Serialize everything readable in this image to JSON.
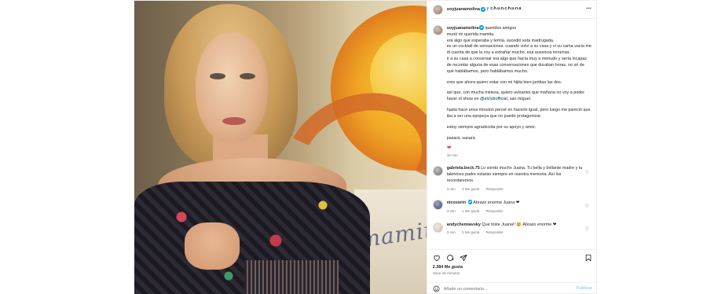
{
  "post": {
    "image_painting_text": "mamita",
    "header": {
      "username": "soyjuanamolina",
      "separator": "y",
      "collaborator": "c.h.u.n.c.h.u.n.a",
      "more_icon": "more-horizontal-icon"
    },
    "caption": {
      "username": "soyjuanamolina",
      "paragraphs": [
        "queridos amigos\nmurió mi querida mamita.\nera algo que esperaba y temía. sucedió esta madrugada.\nes un cocktail de sensaciones. cuando volví a su casa y vi su cama vacía me di cuenta de que la voy a extrañar mucho. esa ausencia inmensa.\nir a su casa a conversar era algo que hacía muy a menudo y sería incapaz de recordar alguna de esas conversaciones que duraban horas. no sé de qué hablábamos, pero hablábamos mucho.",
        "creo que ahora quiero estar con mi hijita bien juntitas las dos.",
        "así que, con mucha tristeza, quiero avisarles que mañana no voy a poder hacer el show en",
        "hasta hace unos minutos pensé en hacerlo igual, pero luego me pareció que iba a ser una epopeya que no puedo protagonizar.",
        "estoy siempre agradecida por su apoyo y amor.",
        "pasará, sanará"
      ],
      "mention": "@elclubofficial",
      "mention_suffix": ", san miguel.",
      "heart": "❤",
      "time": "15 min"
    },
    "comments": [
      {
        "username": "gabriela.beck.75",
        "text": "Lo siento mucho Juana. Tu bella y brillante madre y tu talentoso padre estarán siempre en nuestra memoria. Así los recordaremos.",
        "time": "3 min",
        "likes": "3 Me gusta",
        "reply": "Responder"
      },
      {
        "username": "nicosorin",
        "text": "Abrazo enorme Juana ❤",
        "time": "3 min",
        "likes": "1 Me gusta",
        "reply": "Responder"
      },
      {
        "username": "andychemiavsky",
        "text": "Que triste Juana!! 😢 Abrazo enorme ❤",
        "time": "3 min",
        "likes": "2 Me gusta",
        "reply": "Responder"
      }
    ],
    "actions": {
      "likes": "2.384 Me gusta",
      "time": "Hace 15 minutos",
      "icons": [
        "heart-icon",
        "comment-icon",
        "share-icon",
        "bookmark-icon"
      ]
    },
    "add_comment": {
      "placeholder": "Añade un comentario...",
      "publish": "Publicar"
    },
    "colors": {
      "verified": "#0095f6",
      "heart_red": "#ed4956",
      "link": "#00376b",
      "muted": "#737373",
      "publish_disabled": "#9ecff7"
    }
  }
}
